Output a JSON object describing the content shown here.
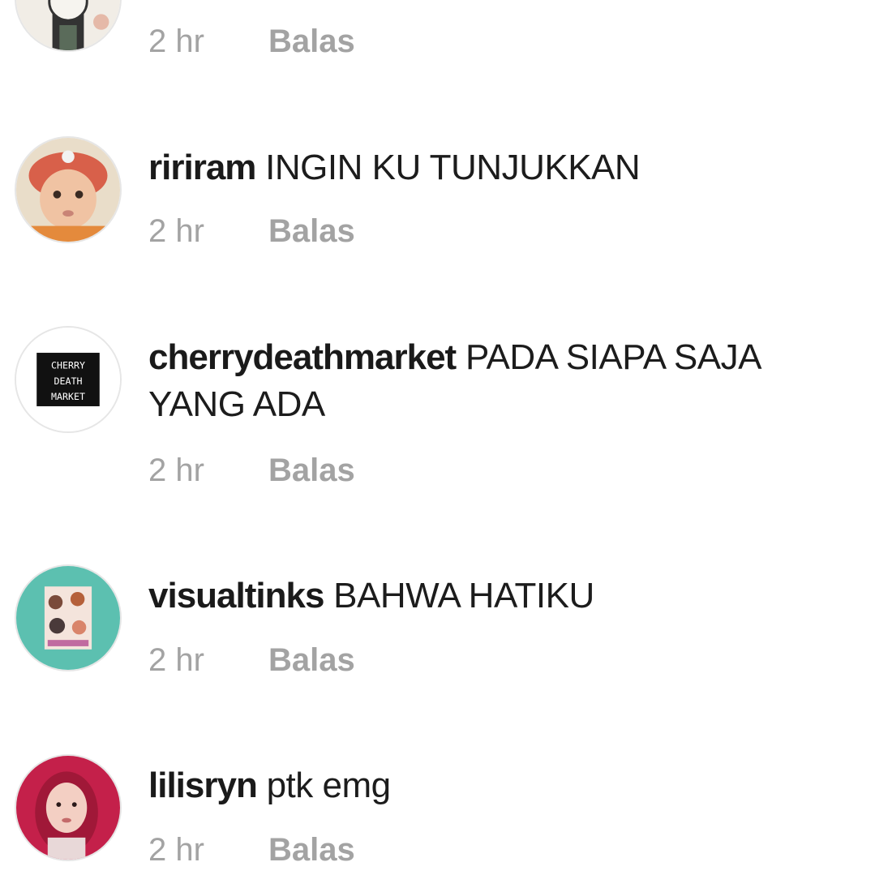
{
  "comments": [
    {
      "username": "",
      "text": "",
      "time": "2 hr",
      "reply_label": "Balas",
      "avatar_icon": "girl-cartoon-avatar"
    },
    {
      "username": "ririram",
      "text": "INGIN KU TUNJUKKAN",
      "time": "2 hr",
      "reply_label": "Balas",
      "avatar_icon": "baby-photo-avatar"
    },
    {
      "username": "cherrydeathmarket",
      "text": "PADA SIAPA SAJA YANG ADA",
      "time": "2 hr",
      "reply_label": "Balas",
      "avatar_icon": "cherry-death-market-logo",
      "avatar_text": [
        "CHERRY",
        "DEATH",
        "MARKET"
      ]
    },
    {
      "username": "visualtinks",
      "text": "BAHWA HATIKU",
      "time": "2 hr",
      "reply_label": "Balas",
      "avatar_icon": "group-photo-avatar"
    },
    {
      "username": "lilisryn",
      "text": "ptk emg",
      "time": "2 hr",
      "reply_label": "Balas",
      "avatar_icon": "hijab-selfie-avatar"
    }
  ],
  "colors": {
    "meta_text": "#a3a3a3",
    "comment_text": "#1c1c1c",
    "background": "#ffffff"
  }
}
